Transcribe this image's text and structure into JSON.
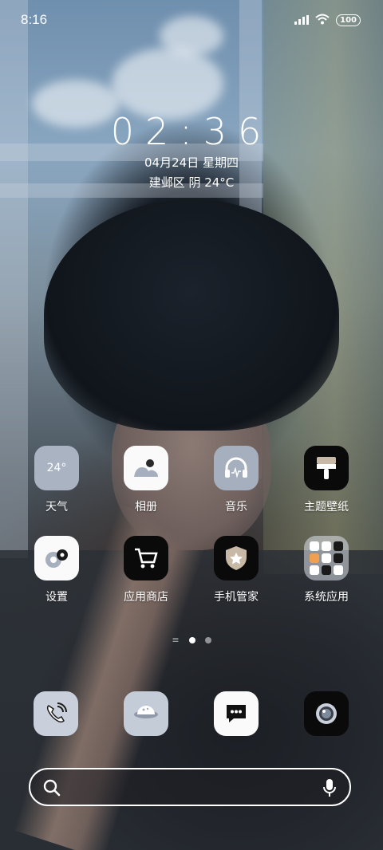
{
  "status_bar": {
    "time": "8:16",
    "battery": "100"
  },
  "lockclock": {
    "time": "02:36",
    "date": "04月24日 星期四",
    "weather": "建邺区 阴 24°C"
  },
  "apps_row1": [
    {
      "label": "天气",
      "icon": "weather-icon",
      "temp": "24°"
    },
    {
      "label": "相册",
      "icon": "gallery-icon"
    },
    {
      "label": "音乐",
      "icon": "music-icon"
    },
    {
      "label": "主题壁纸",
      "icon": "themes-icon"
    }
  ],
  "apps_row2": [
    {
      "label": "设置",
      "icon": "settings-icon"
    },
    {
      "label": "应用商店",
      "icon": "app-store-icon"
    },
    {
      "label": "手机管家",
      "icon": "security-icon"
    },
    {
      "label": "系统应用",
      "icon": "folder-icon"
    }
  ],
  "dock": [
    {
      "icon": "phone-icon"
    },
    {
      "icon": "browser-icon"
    },
    {
      "icon": "messages-icon"
    },
    {
      "icon": "camera-icon"
    }
  ],
  "page_indicator": {
    "pages": 3,
    "active": 1
  },
  "colors": {
    "white": "#ffffff",
    "icon_gray": "#a5afbd",
    "icon_black": "#0a0a0a"
  }
}
